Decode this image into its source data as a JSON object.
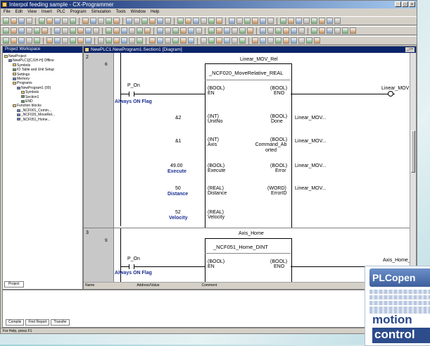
{
  "window": {
    "title": "Interpol feeding sample - CX-Programmer"
  },
  "menu": [
    "File",
    "Edit",
    "View",
    "Insert",
    "PLC",
    "Program",
    "Simulation",
    "Tools",
    "Window",
    "Help"
  ],
  "workspace": {
    "title": "Project Workspace",
    "tree": [
      "NewProject",
      "NewPLC1[CJ1H-H] Offline",
      "Symbols",
      "IO Table and Unit Setup",
      "Settings",
      "Memory",
      "Programs",
      "NewProgram1 (00)",
      "Symbols",
      "Section1",
      "END",
      "Function blocks",
      "_NCF001_Comm...",
      "_NCF020_MoveRel...",
      "_NCF051_Home..."
    ],
    "tab": "Project"
  },
  "diagram": {
    "title": "NewPLC1.NewProgram1.Section1 [Diagram]",
    "rungs": [
      {
        "num": "2",
        "step": "6",
        "instance": "Linear_MOV_Rel",
        "fb": "_NCF020_MoveRelative_REAL",
        "contact": "P_On",
        "contact_comment": "Always ON Flag",
        "output": "Linear_MOV",
        "inputs": [
          {
            "value": "&2",
            "comment": "",
            "type": "(INT)",
            "name": "UnitNo"
          },
          {
            "value": "&1",
            "comment": "",
            "type": "(INT)",
            "name": "Axis"
          },
          {
            "value": "49.00",
            "comment": "Execute",
            "type": "(BOOL)",
            "name": "Execute"
          },
          {
            "value": "50",
            "comment": "Distance",
            "type": "(REAL)",
            "name": "Distance"
          },
          {
            "value": "52",
            "comment": "Velocity",
            "type": "(REAL)",
            "name": "Velocity"
          }
        ],
        "en": {
          "type": "(BOOL)",
          "name": "EN"
        },
        "eno": {
          "type": "(BOOL)",
          "name": "ENO"
        },
        "outputs": [
          {
            "type": "(BOOL)",
            "name": "Done",
            "target": "Linear_MOV..."
          },
          {
            "type": "(BOOL)",
            "name": "Command_Ab orted",
            "target": "Linear_MOV..."
          },
          {
            "type": "(BOOL)",
            "name": "Error",
            "target": "Linear_MOV..."
          },
          {
            "type": "(WORD)",
            "name": "ErrorID",
            "target": "Linear_MOV..."
          }
        ]
      },
      {
        "num": "3",
        "step": "9",
        "instance": "Axis_Home",
        "fb": "_NCF051_Home_DINT",
        "contact": "P_On",
        "contact_comment": "Always ON Flag",
        "output": "Axis_Home_",
        "en": {
          "type": "(BOOL)",
          "name": "EN"
        },
        "eno": {
          "type": "(BOOL)",
          "name": "ENO"
        }
      }
    ],
    "hscroll_labels": [
      "Name",
      "Address/Value",
      "Comment"
    ]
  },
  "output": {
    "tabs": [
      "Compile",
      "Find Report",
      "Transfer"
    ]
  },
  "status": {
    "left": "For Help, press F1"
  },
  "logo": {
    "top": "PLCopen",
    "line1": "motion",
    "line2": "control"
  },
  "colors": {
    "title_bar": "#0a246a",
    "comment": "#1a2f90",
    "logo_blue": "#2c4c8c"
  }
}
